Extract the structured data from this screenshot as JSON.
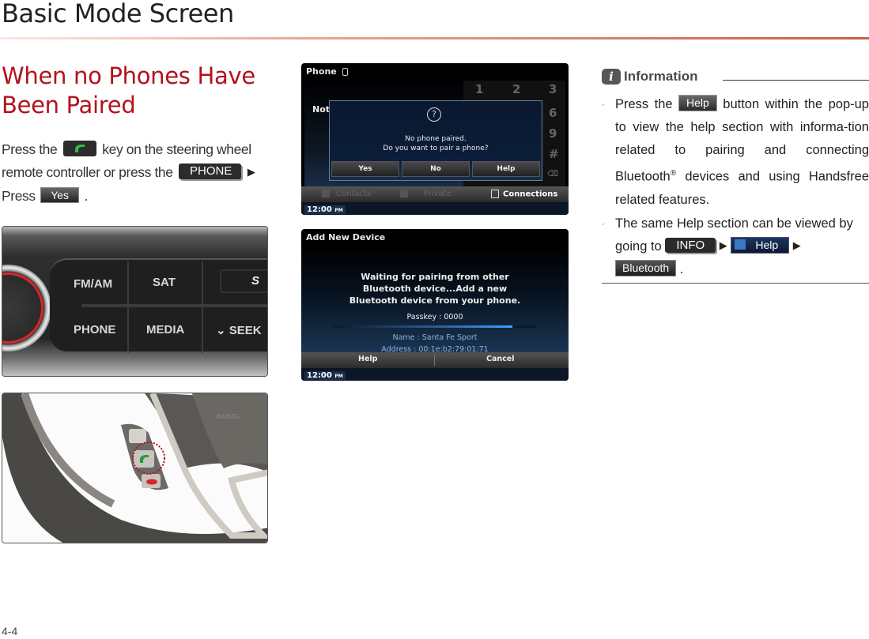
{
  "header": {
    "title": "Basic Mode Screen",
    "accent_color": "#c76048"
  },
  "section": {
    "title": "When no Phones Have Been Paired",
    "title_color": "#b2121b"
  },
  "intro": {
    "text_1": "Press the",
    "call_key_icon": "phone-call-icon",
    "text_2": "key on the steering wheel remote controller or press the",
    "phone_key": "PHONE",
    "arrow": "▶",
    "text_3": "Press",
    "yes_key": "Yes",
    "text_4": "."
  },
  "photos": {
    "radio_panel": {
      "buttons": [
        "FM/AM",
        "SAT",
        "PHONE",
        "MEDIA",
        "SEEK"
      ],
      "partial_label": "S"
    },
    "steering_wheel": {
      "label": "AIRBAG"
    }
  },
  "screen_1": {
    "title": "Phone",
    "status": "Not Connected",
    "keypad": [
      "1",
      "2",
      "3",
      "6",
      "9",
      "#"
    ],
    "popup": {
      "icon": "question-icon",
      "message_line_1": "No phone paired.",
      "message_line_2": "Do you want to pair a phone?",
      "buttons": [
        "Yes",
        "No",
        "Help"
      ]
    },
    "tabs": [
      "Contacts",
      "Private",
      "Connections"
    ],
    "active_tab": "Connections",
    "clock": "12:00",
    "clock_suffix": "PM"
  },
  "screen_2": {
    "title": "Add New Device",
    "message_line_1": "Waiting for pairing from other",
    "message_line_2": "Bluetooth device...Add a new",
    "message_line_3": "Bluetooth device from your phone.",
    "passkey": "Passkey : 0000",
    "progress": 0.88,
    "name": "Name : Santa Fe Sport",
    "address": "Address : 00:1e:b2:79:01:71",
    "buttons": [
      "Help",
      "Cancel"
    ],
    "clock": "12:00",
    "clock_suffix": "PM"
  },
  "info": {
    "title": "Information",
    "icon": "info-icon",
    "item_1": {
      "text_1": "Press the",
      "key": "Help",
      "text_2": "button within the pop-up to view the help section with informa-tion related to pairing and connecting Bluetooth",
      "reg": "®",
      "text_3": "devices and using Handsfree related features."
    },
    "item_2": {
      "text_1": "The same Help section can be viewed by going to",
      "key_1": "INFO",
      "arrow": "▶",
      "key_2": "Help",
      "key_3": "Bluetooth",
      "text_2": "."
    }
  },
  "footer": {
    "page_number": "4-4"
  }
}
